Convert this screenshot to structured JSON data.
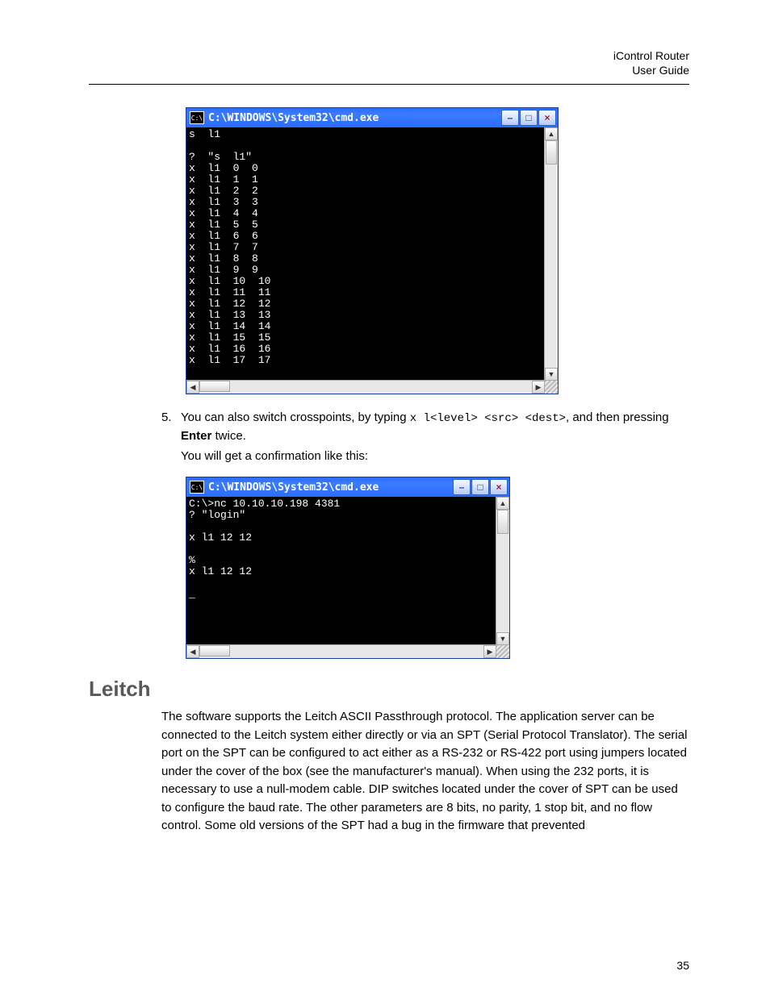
{
  "header": {
    "title": "iControl Router",
    "subtitle": "User Guide"
  },
  "cmd_window": {
    "sysicon_glyph": "C:\\",
    "title": "C:\\WINDOWS\\System32\\cmd.exe",
    "minimize_glyph": "–",
    "maximize_glyph": "□",
    "close_glyph": "×"
  },
  "scrollbar": {
    "up": "▲",
    "down": "▼",
    "left": "◀",
    "right": "▶"
  },
  "cmd1_output": "s  l1\n\n?  \"s  l1\"\nx  l1  0  0\nx  l1  1  1\nx  l1  2  2\nx  l1  3  3\nx  l1  4  4\nx  l1  5  5\nx  l1  6  6\nx  l1  7  7\nx  l1  8  8\nx  l1  9  9\nx  l1  10  10\nx  l1  11  11\nx  l1  12  12\nx  l1  13  13\nx  l1  14  14\nx  l1  15  15\nx  l1  16  16\nx  l1  17  17",
  "cmd2_output": "C:\\>nc 10.10.10.198 4381\n? \"login\"\n\nx l1 12 12\n\n%\nx l1 12 12\n\n_",
  "step5": {
    "num": "5.",
    "pre": "You can also switch crosspoints, by typing ",
    "code": "x l<level> <src> <dest>",
    "mid": ", and then pressing ",
    "enter": "Enter",
    "post": " twice."
  },
  "confirm_line": "You will get a confirmation like this:",
  "section": {
    "heading": "Leitch",
    "body": "The software supports the Leitch ASCII Passthrough protocol. The application server can be connected to the Leitch system either directly or via an SPT (Serial Protocol Translator). The serial port on the SPT can be configured to act either as a RS-232 or RS-422 port using jumpers located under the cover of the box (see the manufacturer's manual). When using the 232 ports, it is necessary to use a null-modem cable. DIP switches located under the cover of SPT can be used to configure the baud rate.  The other parameters are 8 bits, no parity, 1 stop bit, and no flow control. Some old versions of the SPT had a bug in the firmware that prevented"
  },
  "page_number": "35"
}
